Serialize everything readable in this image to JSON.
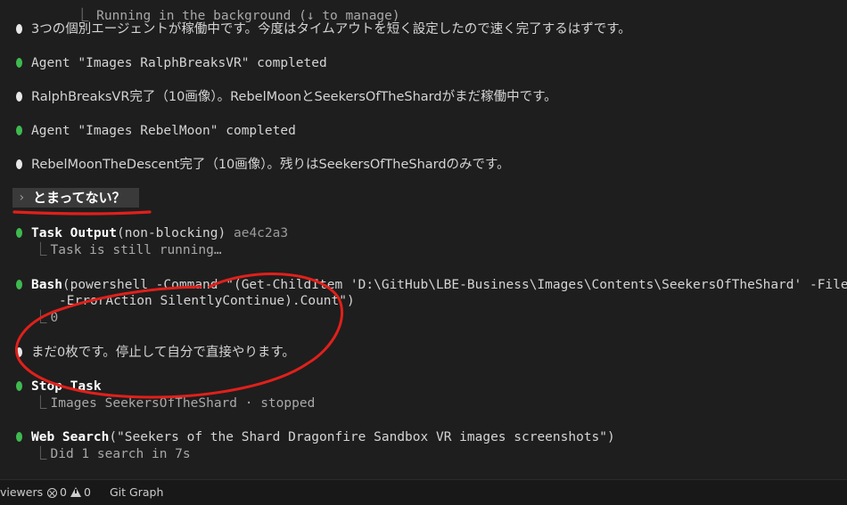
{
  "terminal": {
    "top_partial": "⎿ Running in the background (↓ to manage)",
    "messages": [
      {
        "kind": "text",
        "text": "3つの個別エージェントが稼働中です。今度はタイムアウトを短く設定したので速く完了するはずです。"
      },
      {
        "kind": "agent",
        "text": "Agent \"Images RalphBreaksVR\" completed"
      },
      {
        "kind": "text",
        "text": "RalphBreaksVR完了（10画像）。RebelMoonとSeekersOfTheShardがまだ稼働中です。"
      },
      {
        "kind": "agent",
        "text": "Agent \"Images RebelMoon\" completed"
      },
      {
        "kind": "text",
        "text": "RebelMoonTheDescent完了（10画像）。残りはSeekersOfTheShardのみです。"
      }
    ],
    "prompt": {
      "caret": "›",
      "text": "とまってない？"
    },
    "tools": {
      "task_output": {
        "name": "Task Output",
        "args": "(non-blocking)",
        "id": "ae4c2a3",
        "result": "Task is still running…"
      },
      "bash": {
        "name": "Bash",
        "line1": "(powershell -Command \"(Get-ChildItem 'D:\\GitHub\\LBE-Business\\Images\\Contents\\SeekersOfTheShard' -File",
        "line2": "-ErrorAction SilentlyContinue).Count\")",
        "result": "0"
      },
      "reply": "まだ0枚です。停止して自分で直接やります。",
      "stop_task": {
        "name": "Stop Task",
        "result": "Images SeekersOfTheShard · stopped"
      },
      "web_search": {
        "name": "Web Search",
        "args": "(\"Seekers of the Shard Dragonfire Sandbox VR images screenshots\")",
        "result": "Did 1 search in 7s"
      }
    },
    "branch_glyph": "⎿"
  },
  "statusbar": {
    "viewers": "viewers",
    "errors": "0",
    "warnings": "0",
    "git_graph": "Git Graph"
  },
  "colors": {
    "background": "#1e1e1e",
    "agent_bullet": "#3fb950",
    "text_bullet": "#e8e8e8",
    "annotation": "#e0201b"
  }
}
